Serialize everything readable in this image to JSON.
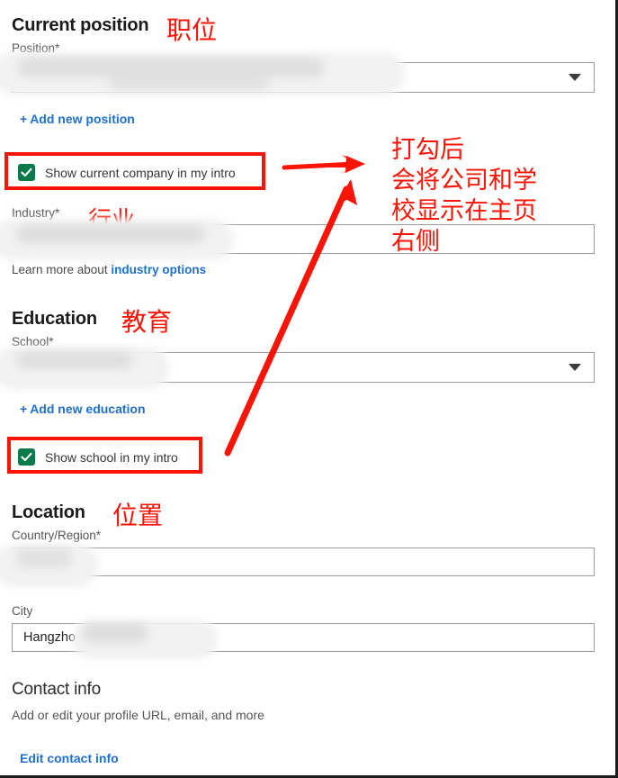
{
  "sections": {
    "current_position": {
      "heading": "Current position",
      "annotation": "职位",
      "position_label": "Position*",
      "position_value": "",
      "add_link": "Add new position",
      "add_link_plus": "+",
      "show_company_checkbox": "Show current company in my intro",
      "industry_label": "Industry*",
      "industry_annotation": "行业",
      "industry_value": "",
      "learn_more_prefix": "Learn more about ",
      "learn_more_link": "industry options"
    },
    "education": {
      "heading": "Education",
      "annotation": "教育",
      "school_label": "School*",
      "school_value": "",
      "add_link": "Add new education",
      "add_link_plus": "+",
      "show_school_checkbox": "Show school in my intro"
    },
    "location": {
      "heading": "Location",
      "annotation": "位置",
      "country_label": "Country/Region*",
      "country_value": "",
      "city_label": "City",
      "city_value": "Hangzho"
    },
    "contact_info": {
      "heading": "Contact info",
      "subtitle": "Add or edit your profile URL, email, and more",
      "edit_link": "Edit contact info"
    }
  },
  "annotations": {
    "checkbox_note": "打勾后\n会将公司和学\n校显示在主页\n右侧",
    "checkbox_note_lines": [
      "打勾后",
      "会将公司和学",
      "校显示在主页",
      "右侧"
    ],
    "arrow_color": "#fa1405",
    "highlight_color": "#fa1405"
  },
  "colors": {
    "checkbox_green": "#0b7a4b",
    "link_blue": "#1f6fd0",
    "annotation_red": "#fa1405",
    "field_border": "#9b9b9b",
    "label_gray": "#555555"
  },
  "icons": {
    "dropdown": "chevron-down-icon",
    "checkmark": "check-icon",
    "plus": "plus-icon"
  }
}
